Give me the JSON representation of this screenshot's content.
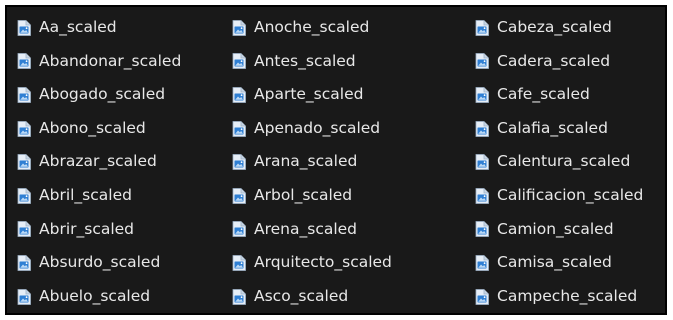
{
  "colors": {
    "background": "#191919",
    "text": "#e8e8e8",
    "icon_page": "#e6eef7",
    "icon_image": "#2f7fd3"
  },
  "file_icon": "image-file-icon",
  "columns": [
    {
      "items": [
        "Aa_scaled",
        "Abandonar_scaled",
        "Abogado_scaled",
        "Abono_scaled",
        "Abrazar_scaled",
        "Abril_scaled",
        "Abrir_scaled",
        "Absurdo_scaled",
        "Abuelo_scaled"
      ]
    },
    {
      "items": [
        "Anoche_scaled",
        "Antes_scaled",
        "Aparte_scaled",
        "Apenado_scaled",
        "Arana_scaled",
        "Arbol_scaled",
        "Arena_scaled",
        "Arquitecto_scaled",
        "Asco_scaled"
      ]
    },
    {
      "items": [
        "Cabeza_scaled",
        "Cadera_scaled",
        "Cafe_scaled",
        "Calafia_scaled",
        "Calentura_scaled",
        "Calificacion_scaled",
        "Camion_scaled",
        "Camisa_scaled",
        "Campeche_scaled"
      ]
    }
  ]
}
